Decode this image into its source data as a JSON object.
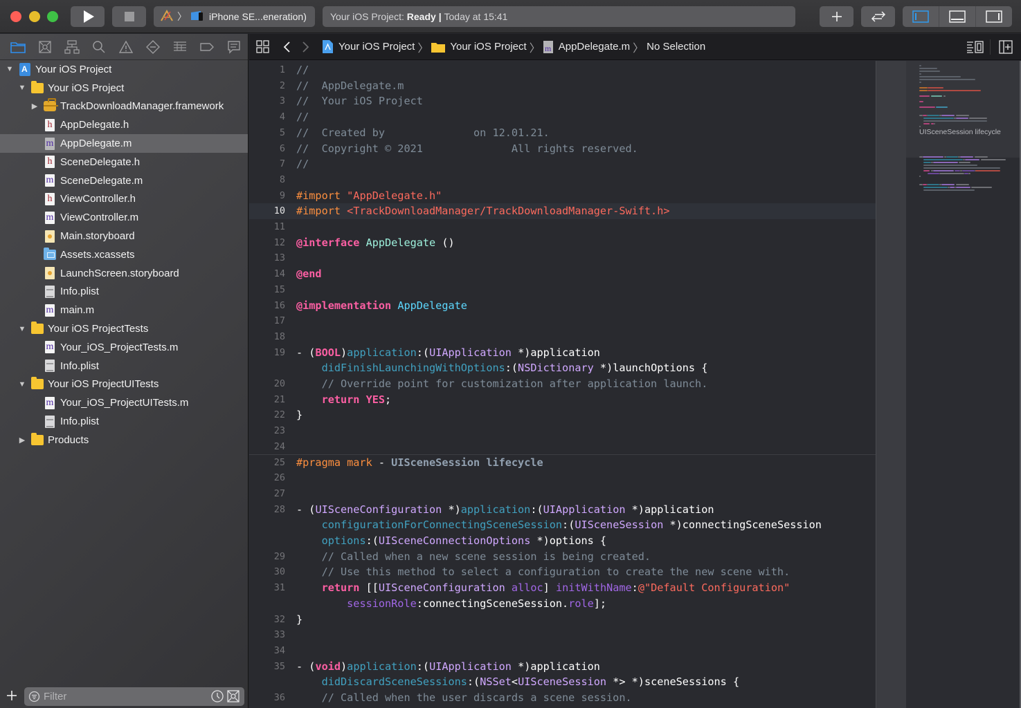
{
  "window": {
    "scheme": {
      "target_icon": "app-target-icon",
      "device_icon": "iphone-device-icon",
      "device": "iPhone SE...eneration)"
    },
    "status": {
      "project": "Your iOS Project:",
      "state": "Ready",
      "divider": "|",
      "time": "Today at 15:41"
    },
    "toolbar_icons": [
      "run-icon",
      "stop-icon",
      "add-icon",
      "code-review-icon",
      "navigator-toggle-icon",
      "debug-area-toggle-icon",
      "inspector-toggle-icon"
    ]
  },
  "navigator": {
    "tabs": [
      "project-navigator",
      "source-control-navigator",
      "symbol-navigator",
      "find-navigator",
      "issue-navigator",
      "test-navigator",
      "debug-navigator",
      "breakpoint-navigator",
      "report-navigator"
    ],
    "tree": [
      {
        "label": "Your iOS Project",
        "kind": "project",
        "level": 0,
        "expanded": true
      },
      {
        "label": "Your iOS Project",
        "kind": "folder",
        "level": 1,
        "expanded": true
      },
      {
        "label": "TrackDownloadManager.framework",
        "kind": "framework",
        "level": 2,
        "expanded": false
      },
      {
        "label": "AppDelegate.h",
        "kind": "h",
        "level": 2
      },
      {
        "label": "AppDelegate.m",
        "kind": "m",
        "level": 2,
        "selected": true
      },
      {
        "label": "SceneDelegate.h",
        "kind": "h",
        "level": 2
      },
      {
        "label": "SceneDelegate.m",
        "kind": "m",
        "level": 2
      },
      {
        "label": "ViewController.h",
        "kind": "h",
        "level": 2
      },
      {
        "label": "ViewController.m",
        "kind": "m",
        "level": 2
      },
      {
        "label": "Main.storyboard",
        "kind": "storyboard",
        "level": 2
      },
      {
        "label": "Assets.xcassets",
        "kind": "assets",
        "level": 2
      },
      {
        "label": "LaunchScreen.storyboard",
        "kind": "storyboard",
        "level": 2
      },
      {
        "label": "Info.plist",
        "kind": "plist",
        "level": 2
      },
      {
        "label": "main.m",
        "kind": "m",
        "level": 2
      },
      {
        "label": "Your iOS ProjectTests",
        "kind": "folder",
        "level": 1,
        "expanded": true
      },
      {
        "label": "Your_iOS_ProjectTests.m",
        "kind": "m",
        "level": 2
      },
      {
        "label": "Info.plist",
        "kind": "plist",
        "level": 2
      },
      {
        "label": "Your iOS ProjectUITests",
        "kind": "folder",
        "level": 1,
        "expanded": true
      },
      {
        "label": "Your_iOS_ProjectUITests.m",
        "kind": "m",
        "level": 2
      },
      {
        "label": "Info.plist",
        "kind": "plist",
        "level": 2
      },
      {
        "label": "Products",
        "kind": "folder",
        "level": 1,
        "expanded": false
      }
    ],
    "filter": {
      "placeholder": "Filter",
      "value": ""
    }
  },
  "jumpbar": {
    "crumbs": [
      {
        "label": "Your iOS Project",
        "icon": "project-icon"
      },
      {
        "label": "Your iOS Project",
        "icon": "folder-icon"
      },
      {
        "label": "AppDelegate.m",
        "icon": "m-file-icon"
      },
      {
        "label": "No Selection",
        "icon": ""
      }
    ]
  },
  "editor": {
    "current_line": 10,
    "lines": [
      {
        "n": "1",
        "tokens": [
          [
            "c-comment",
            "//"
          ]
        ]
      },
      {
        "n": "2",
        "tokens": [
          [
            "c-comment",
            "//  AppDelegate.m"
          ]
        ]
      },
      {
        "n": "3",
        "tokens": [
          [
            "c-comment",
            "//  Your iOS Project"
          ]
        ]
      },
      {
        "n": "4",
        "tokens": [
          [
            "c-comment",
            "//"
          ]
        ]
      },
      {
        "n": "5",
        "tokens": [
          [
            "c-comment",
            "//  Created by              on 12.01.21."
          ]
        ]
      },
      {
        "n": "6",
        "tokens": [
          [
            "c-comment",
            "//  Copyright © 2021              All rights reserved."
          ]
        ]
      },
      {
        "n": "7",
        "tokens": [
          [
            "c-comment",
            "//"
          ]
        ]
      },
      {
        "n": "8",
        "tokens": []
      },
      {
        "n": "9",
        "tokens": [
          [
            "c-pre",
            "#import "
          ],
          [
            "c-str",
            "\"AppDelegate.h\""
          ]
        ]
      },
      {
        "n": "10",
        "tokens": [
          [
            "c-pre",
            "#import "
          ],
          [
            "c-str",
            "<TrackDownloadManager/TrackDownloadManager-Swift.h>"
          ]
        ]
      },
      {
        "n": "11",
        "tokens": []
      },
      {
        "n": "12",
        "tokens": [
          [
            "c-kw",
            "@interface"
          ],
          [
            "c-plain",
            " "
          ],
          [
            "c-cls",
            "AppDelegate"
          ],
          [
            "c-plain",
            " ()"
          ]
        ]
      },
      {
        "n": "13",
        "tokens": []
      },
      {
        "n": "14",
        "tokens": [
          [
            "c-kw",
            "@end"
          ]
        ]
      },
      {
        "n": "15",
        "tokens": []
      },
      {
        "n": "16",
        "tokens": [
          [
            "c-kw",
            "@implementation"
          ],
          [
            "c-plain",
            " "
          ],
          [
            "c-cls2",
            "AppDelegate"
          ]
        ]
      },
      {
        "n": "17",
        "tokens": []
      },
      {
        "n": "18",
        "tokens": []
      },
      {
        "n": "19",
        "tokens": [
          [
            "c-plain",
            "- ("
          ],
          [
            "c-kw",
            "BOOL"
          ],
          [
            "c-plain",
            ")"
          ],
          [
            "c-fn",
            "application"
          ],
          [
            "c-plain",
            ":("
          ],
          [
            "c-type",
            "UIApplication"
          ],
          [
            "c-plain",
            " *)application"
          ]
        ]
      },
      {
        "n": "",
        "tokens": [
          [
            "c-plain",
            "    "
          ],
          [
            "c-fn",
            "didFinishLaunchingWithOptions"
          ],
          [
            "c-plain",
            ":("
          ],
          [
            "c-type",
            "NSDictionary"
          ],
          [
            "c-plain",
            " *)launchOptions {"
          ]
        ]
      },
      {
        "n": "20",
        "tokens": [
          [
            "c-plain",
            "    "
          ],
          [
            "c-comment",
            "// Override point for customization after application launch."
          ]
        ]
      },
      {
        "n": "21",
        "tokens": [
          [
            "c-plain",
            "    "
          ],
          [
            "c-kw",
            "return"
          ],
          [
            "c-plain",
            " "
          ],
          [
            "c-kw",
            "YES"
          ],
          [
            "c-plain",
            ";"
          ]
        ]
      },
      {
        "n": "22",
        "tokens": [
          [
            "c-plain",
            "}"
          ]
        ]
      },
      {
        "n": "23",
        "tokens": []
      },
      {
        "n": "24",
        "tokens": []
      },
      {
        "n": "25",
        "tokens": [
          [
            "c-pre",
            "#pragma mark"
          ],
          [
            "c-plain",
            " - "
          ],
          [
            "c-mark",
            "UISceneSession lifecycle"
          ]
        ],
        "mark": true
      },
      {
        "n": "26",
        "tokens": []
      },
      {
        "n": "27",
        "tokens": []
      },
      {
        "n": "28",
        "tokens": [
          [
            "c-plain",
            "- ("
          ],
          [
            "c-type",
            "UISceneConfiguration"
          ],
          [
            "c-plain",
            " *)"
          ],
          [
            "c-fn",
            "application"
          ],
          [
            "c-plain",
            ":("
          ],
          [
            "c-type",
            "UIApplication"
          ],
          [
            "c-plain",
            " *)application"
          ]
        ]
      },
      {
        "n": "",
        "tokens": [
          [
            "c-plain",
            "    "
          ],
          [
            "c-fn",
            "configurationForConnectingSceneSession"
          ],
          [
            "c-plain",
            ":("
          ],
          [
            "c-type",
            "UISceneSession"
          ],
          [
            "c-plain",
            " *)connectingSceneSession"
          ]
        ]
      },
      {
        "n": "",
        "tokens": [
          [
            "c-plain",
            "    "
          ],
          [
            "c-fn",
            "options"
          ],
          [
            "c-plain",
            ":("
          ],
          [
            "c-type",
            "UISceneConnectionOptions"
          ],
          [
            "c-plain",
            " *)options {"
          ]
        ]
      },
      {
        "n": "29",
        "tokens": [
          [
            "c-plain",
            "    "
          ],
          [
            "c-comment",
            "// Called when a new scene session is being created."
          ]
        ]
      },
      {
        "n": "30",
        "tokens": [
          [
            "c-plain",
            "    "
          ],
          [
            "c-comment",
            "// Use this method to select a configuration to create the new scene with."
          ]
        ]
      },
      {
        "n": "31",
        "tokens": [
          [
            "c-plain",
            "    "
          ],
          [
            "c-kw",
            "return"
          ],
          [
            "c-plain",
            " [["
          ],
          [
            "c-type",
            "UISceneConfiguration"
          ],
          [
            "c-plain",
            " "
          ],
          [
            "c-meth",
            "alloc"
          ],
          [
            "c-plain",
            "] "
          ],
          [
            "c-meth",
            "initWithName"
          ],
          [
            "c-plain",
            ":"
          ],
          [
            "c-str",
            "@\"Default Configuration\""
          ]
        ]
      },
      {
        "n": "",
        "tokens": [
          [
            "c-plain",
            "        "
          ],
          [
            "c-meth",
            "sessionRole"
          ],
          [
            "c-plain",
            ":connectingSceneSession."
          ],
          [
            "c-meth",
            "role"
          ],
          [
            "c-plain",
            "];"
          ]
        ]
      },
      {
        "n": "32",
        "tokens": [
          [
            "c-plain",
            "}"
          ]
        ]
      },
      {
        "n": "33",
        "tokens": []
      },
      {
        "n": "34",
        "tokens": []
      },
      {
        "n": "35",
        "tokens": [
          [
            "c-plain",
            "- ("
          ],
          [
            "c-kw",
            "void"
          ],
          [
            "c-plain",
            ")"
          ],
          [
            "c-fn",
            "application"
          ],
          [
            "c-plain",
            ":("
          ],
          [
            "c-type",
            "UIApplication"
          ],
          [
            "c-plain",
            " *)application"
          ]
        ]
      },
      {
        "n": "",
        "tokens": [
          [
            "c-plain",
            "    "
          ],
          [
            "c-fn",
            "didDiscardSceneSessions"
          ],
          [
            "c-plain",
            ":("
          ],
          [
            "c-type",
            "NSSet"
          ],
          [
            "c-plain",
            "<"
          ],
          [
            "c-type",
            "UISceneSession"
          ],
          [
            "c-plain",
            " *> *)sceneSessions {"
          ]
        ]
      },
      {
        "n": "36",
        "tokens": [
          [
            "c-plain",
            "    "
          ],
          [
            "c-comment",
            "// Called when the user discards a scene session."
          ]
        ]
      }
    ]
  },
  "minimap": {
    "section_label": "UISceneSession lifecycle"
  },
  "colors": {
    "accent": "#2f8ff0",
    "comment": "#7f8c98",
    "keyword": "#fc5fa3",
    "string": "#fc6a5d",
    "preprocessor": "#fd8f3f",
    "type": "#d0a8ff",
    "function": "#41a1c0"
  }
}
